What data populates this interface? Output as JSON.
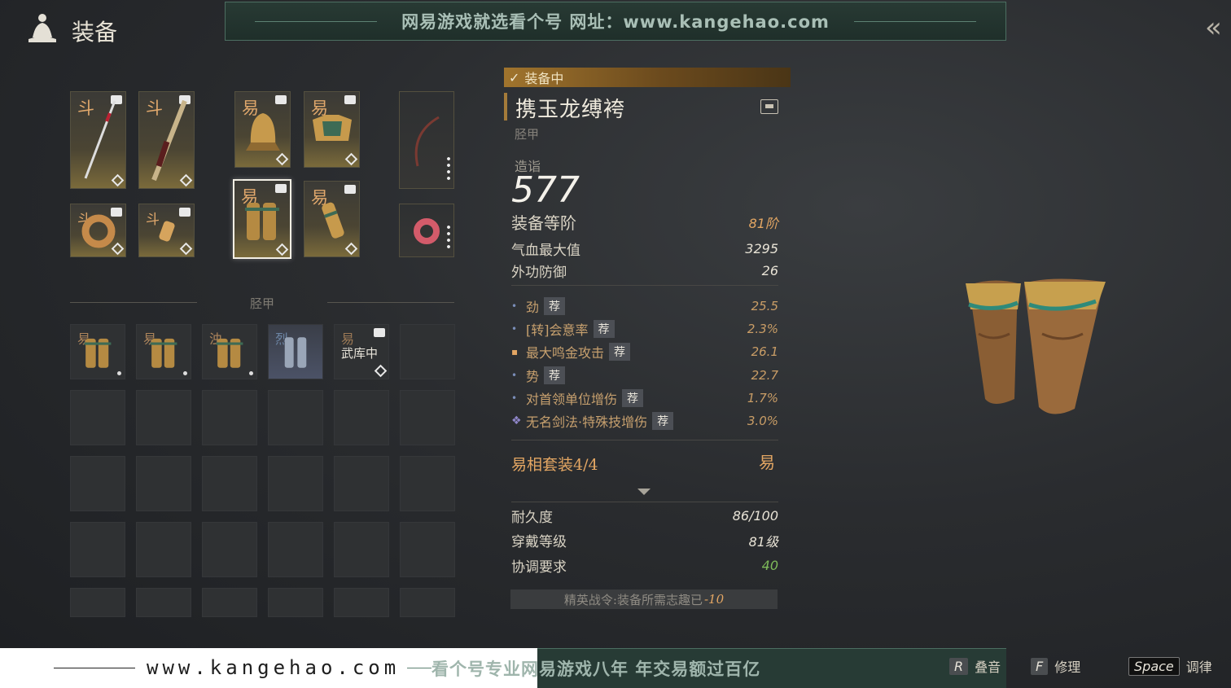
{
  "header": {
    "title": "装备"
  },
  "banner": {
    "text": "网易游戏就选看个号  网址：www.kangehao.com"
  },
  "weapons": [
    {
      "mark": "斗",
      "kind": "spear"
    },
    {
      "mark": "斗",
      "kind": "sword"
    },
    {
      "mark": "斗",
      "kind": "ring"
    },
    {
      "mark": "斗",
      "kind": "pendant"
    }
  ],
  "armor": [
    {
      "mark": "易",
      "kind": "helmet"
    },
    {
      "mark": "易",
      "kind": "chest"
    },
    {
      "mark": "易",
      "kind": "greaves",
      "selected": true
    },
    {
      "mark": "易",
      "kind": "gloves"
    }
  ],
  "inventory": {
    "section_label": "胫甲",
    "stored_label": "武库中",
    "items": [
      {
        "mark": "易"
      },
      {
        "mark": "易"
      },
      {
        "mark": "浊"
      },
      {
        "mark": "烈"
      },
      {
        "mark": "易",
        "stored": true
      }
    ]
  },
  "detail": {
    "equipped_label": "装备中",
    "name": "携玉龙缚袴",
    "type": "胫甲",
    "score_label": "造诣",
    "score": "577",
    "tier_label": "装备等阶",
    "tier_value": "81阶",
    "stats": [
      {
        "label": "气血最大值",
        "value": "3295"
      },
      {
        "label": "外功防御",
        "value": "26"
      }
    ],
    "recommend_label": "荐",
    "substats": [
      {
        "label": "劲",
        "value": "25.5",
        "recommended": true,
        "bullet": "•"
      },
      {
        "label": "[转]会意率",
        "value": "2.3%",
        "recommended": true,
        "bullet": "•"
      },
      {
        "label": "最大鸣金攻击",
        "value": "26.1",
        "recommended": true,
        "bullet": "▪"
      },
      {
        "label": "势",
        "value": "22.7",
        "recommended": true,
        "bullet": "•"
      },
      {
        "label": "对首领单位增伤",
        "value": "1.7%",
        "recommended": true,
        "bullet": "•"
      },
      {
        "label": "无名剑法·特殊技增伤",
        "value": "3.0%",
        "recommended": true,
        "bullet": "❖"
      }
    ],
    "set_title": "易相套装4/4",
    "set_mark": "易",
    "durability_label": "耐久度",
    "durability_value": "86/100",
    "wear_level_label": "穿戴等级",
    "wear_level_value": "81级",
    "coordination_label": "协调要求",
    "coordination_value": "40",
    "elite_text": "精英战令:装备所需志趣已",
    "elite_value": "-10"
  },
  "footer": {
    "site": "www.kangehao.com",
    "slogan": "看个号专业网易游戏八年  年交易额过百亿",
    "hints": [
      {
        "key": "R",
        "label": "叠音"
      },
      {
        "key": "F",
        "label": "修理"
      },
      {
        "key": "Space",
        "label": "调律"
      }
    ]
  },
  "colors": {
    "accent": "#e3a663",
    "green": "#7ebb5a",
    "selected_border": "#f2eee4"
  }
}
